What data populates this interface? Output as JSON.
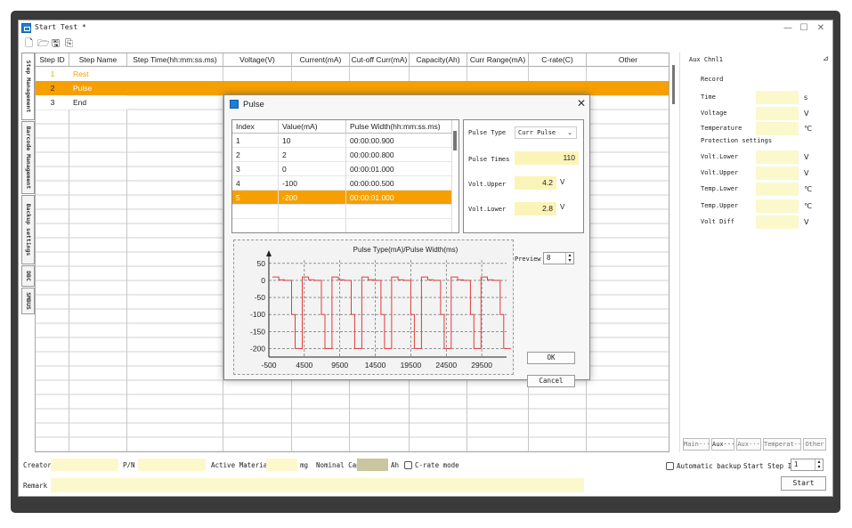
{
  "window": {
    "title": "Start Test *",
    "minimize": "—",
    "restore": "☐",
    "close": "✕"
  },
  "toolbar_icons": [
    "new-file-icon",
    "open-folder-icon",
    "save-icon",
    "save-as-icon"
  ],
  "vertical_tabs": [
    "Step Management",
    "Barcode Management",
    "Backup settings",
    "DBC",
    "SMBUS"
  ],
  "grid": {
    "columns": [
      "Step ID",
      "Step Name",
      "Step Time(hh:mm:ss.ms)",
      "Voltage(V)",
      "Current(mA)",
      "Cut-off Curr(mA)",
      "Capacity(Ah)",
      "Curr Range(mA)",
      "C-rate(C)",
      "Other"
    ],
    "rows": [
      {
        "id": "1",
        "name": "Rest"
      },
      {
        "id": "2",
        "name": "Pulse"
      },
      {
        "id": "3",
        "name": "End"
      }
    ],
    "selected_row": 1
  },
  "aux_panel": {
    "title": "Aux Chnl1",
    "pin": "⊿",
    "record_label": "Record",
    "fields": [
      {
        "label": "Time",
        "unit": "s"
      },
      {
        "label": "Voltage",
        "unit": "V"
      },
      {
        "label": "Temperature",
        "unit": "℃"
      }
    ],
    "protection_label": "Protection settings",
    "protection": [
      {
        "label": "Volt.Lower",
        "unit": "V"
      },
      {
        "label": "Volt.Upper",
        "unit": "V"
      },
      {
        "label": "Temp.Lower",
        "unit": "℃"
      },
      {
        "label": "Temp.Upper",
        "unit": "℃"
      },
      {
        "label": "Volt Diff",
        "unit": "V"
      }
    ],
    "tabs": [
      "Main···",
      "Aux···",
      "Aux···",
      "Temperat···",
      "Other"
    ],
    "active_tab": 1
  },
  "bottom": {
    "creator_label": "Creator",
    "pn_label": "P/N",
    "active_material_label": "Active Material",
    "active_material_unit": "mg",
    "nominal_cap_label": "Nominal Cap",
    "nominal_cap_unit": "Ah",
    "crate_mode_label": "C-rate mode",
    "auto_backup_label": "Automatic backup",
    "start_step_label": "Start Step ID",
    "start_step_value": "1",
    "remark_label": "Remark",
    "start_button": "Start"
  },
  "dialog": {
    "title": "Pulse",
    "table": {
      "columns": [
        "Index",
        "Value(mA)",
        "Pulse Width(hh:mm:ss.ms)"
      ],
      "rows": [
        {
          "index": "1",
          "value": "10",
          "width": "00:00:00.900"
        },
        {
          "index": "2",
          "value": "2",
          "width": "00:00:00.800"
        },
        {
          "index": "3",
          "value": "0",
          "width": "00:00:01.000"
        },
        {
          "index": "4",
          "value": "-100",
          "width": "00:00:00.500"
        },
        {
          "index": "5",
          "value": "-200",
          "width": "00:00:01.000"
        }
      ],
      "selected_row": 4
    },
    "props": {
      "pulse_type_label": "Pulse Type",
      "pulse_type_value": "Curr Pulse",
      "pulse_times_label": "Pulse Times",
      "pulse_times_value": "110",
      "volt_upper_label": "Volt.Upper",
      "volt_upper_value": "4.2",
      "volt_lower_label": "Volt.Lower",
      "volt_lower_value": "2.8",
      "volt_unit": "V"
    },
    "preview_label": "Preview",
    "preview_value": "8",
    "ok_button": "OK",
    "cancel_button": "Cancel"
  },
  "colors": {
    "selected_row": "#f5a000",
    "field_yellow": "#fbf8cc",
    "plot_line": "#e23b3b",
    "rest_text": "#f5a000"
  },
  "chart_data": {
    "type": "line",
    "title": "Pulse Type(mA)/Pulse Width(ms)",
    "xlabel": "",
    "ylabel": "",
    "xlim": [
      -500,
      33000
    ],
    "ylim": [
      -225,
      60
    ],
    "x_ticks": [
      -500,
      4500,
      9500,
      14500,
      19500,
      24500,
      29500
    ],
    "y_ticks": [
      50,
      0,
      -50,
      -100,
      -150,
      -200
    ],
    "grid": true,
    "pulse_sequence": [
      {
        "value": 10,
        "width_ms": 900
      },
      {
        "value": 2,
        "width_ms": 800
      },
      {
        "value": 0,
        "width_ms": 1000
      },
      {
        "value": -100,
        "width_ms": 500
      },
      {
        "value": -200,
        "width_ms": 1000
      }
    ],
    "repeats": 8
  }
}
